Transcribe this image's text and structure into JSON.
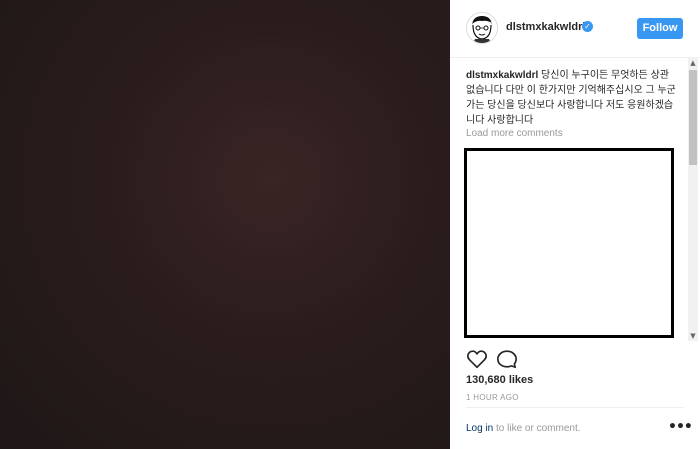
{
  "post": {
    "username": "dlstmxkakwldrl",
    "verified_icon": "verified-badge-icon",
    "follow_label": "Follow",
    "caption_text": "당신이 누구이든 무엇하든 상관없습니다 다만 이 한가지만 기억해주십시오 그 누군가는 당신을 당신보다 사랑합니다 저도 응원하겠습니다 사랑합니다",
    "load_more_label": "Load more comments",
    "likes": "130,680 likes",
    "time_ago": "1 HOUR AGO",
    "login_link": "Log in",
    "login_suffix": " to like or comment.",
    "more_icon": "more-options-icon",
    "accent_color": "#3897f0"
  }
}
